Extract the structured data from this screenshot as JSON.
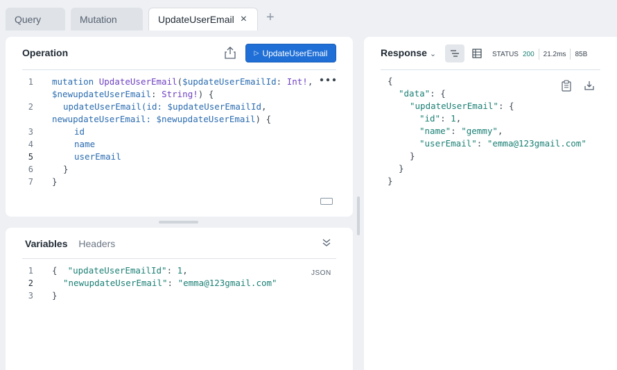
{
  "tabs": [
    {
      "label": "Query"
    },
    {
      "label": "Mutation"
    },
    {
      "label": "UpdateUserEmail",
      "close": "×"
    }
  ],
  "tab_add": "+",
  "operation": {
    "title": "Operation",
    "run_button": "UpdateUserEmail",
    "run_icon": "▷",
    "line_numbers": [
      "1",
      "",
      "2",
      "",
      "3",
      "4",
      "5",
      "6",
      "7"
    ],
    "code": {
      "l1a": "mutation",
      "l1b": "UpdateUserEmail",
      "l1c": "(",
      "l1d": "$updateUserEmailId",
      "l1e": ": ",
      "l1f": "Int!",
      "l1g": ",",
      "l1h": "$newupdateUserEmail",
      "l1i": ": ",
      "l1j": "String!",
      "l1k": ") {",
      "l2a": "updateUserEmail",
      "l2b": "(id: ",
      "l2c": "$updateUserEmailId",
      "l2d": ",",
      "l2e": "newupdateUserEmail: ",
      "l2f": "$newupdateUserEmail",
      "l2g": ") {",
      "l3": "id",
      "l4": "name",
      "l5": "userEmail",
      "l6": "}",
      "l7": "}"
    }
  },
  "variables": {
    "tab_active": "Variables",
    "tab_inactive": "Headers",
    "json_tag": "JSON",
    "line_numbers": [
      "1",
      "2",
      "3"
    ],
    "open_brace": "{",
    "key1": "\"updateUserEmailId\"",
    "val1": "1",
    "key2": "\"newupdateUserEmail\"",
    "val2": "\"emma@123gmail.com\"",
    "close_brace": "}"
  },
  "response": {
    "title": "Response",
    "status_label": "STATUS",
    "status_code": "200",
    "time": "21.2ms",
    "size": "85B",
    "json": {
      "data_key": "\"data\"",
      "update_key": "\"updateUserEmail\"",
      "id_key": "\"id\"",
      "id_val": "1",
      "name_key": "\"name\"",
      "name_val": "\"gemmy\"",
      "email_key": "\"userEmail\"",
      "email_val": "\"emma@123gmail.com\""
    }
  }
}
